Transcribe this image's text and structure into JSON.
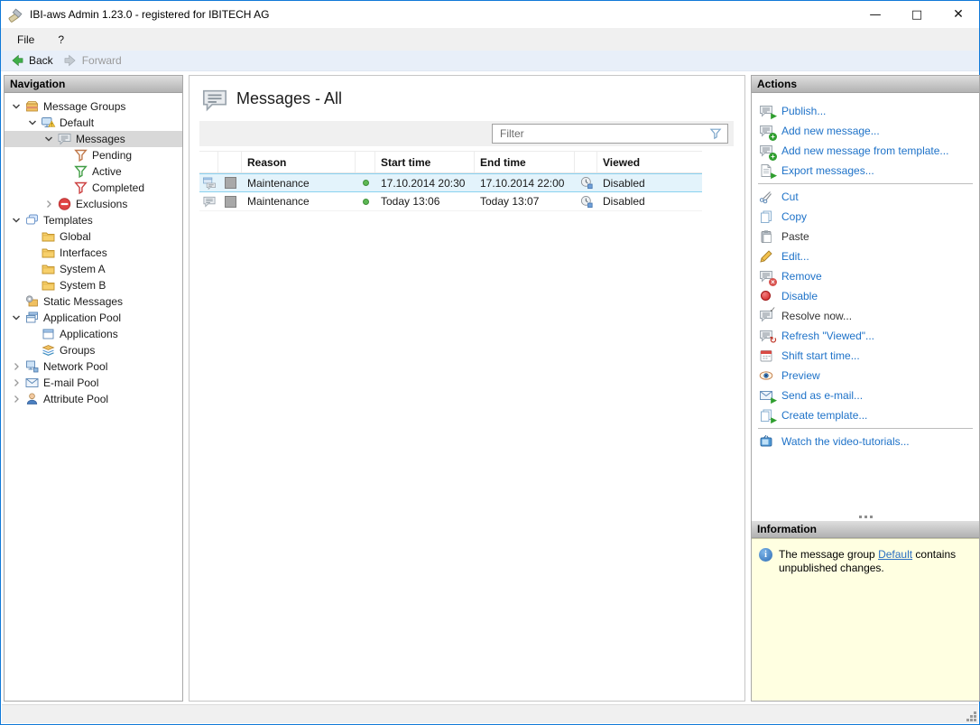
{
  "window": {
    "title": "IBI-aws Admin 1.23.0 - registered for IBITECH AG",
    "controls": {
      "minimize": "—",
      "maximize": "□",
      "close": "✕"
    }
  },
  "menu": {
    "file": "File",
    "help": "?"
  },
  "toolbar": {
    "back": "Back",
    "forward": "Forward"
  },
  "navigation": {
    "header": "Navigation",
    "items": [
      {
        "label": "Message Groups"
      },
      {
        "label": "Default"
      },
      {
        "label": "Messages"
      },
      {
        "label": "Pending"
      },
      {
        "label": "Active"
      },
      {
        "label": "Completed"
      },
      {
        "label": "Exclusions"
      },
      {
        "label": "Templates"
      },
      {
        "label": "Global"
      },
      {
        "label": "Interfaces"
      },
      {
        "label": "System A"
      },
      {
        "label": "System B"
      },
      {
        "label": "Static Messages"
      },
      {
        "label": "Application Pool"
      },
      {
        "label": "Applications"
      },
      {
        "label": "Groups"
      },
      {
        "label": "Network Pool"
      },
      {
        "label": "E-mail Pool"
      },
      {
        "label": "Attribute Pool"
      }
    ]
  },
  "main": {
    "title": "Messages - All",
    "filter": {
      "placeholder": "Filter"
    },
    "table": {
      "columns": {
        "reason": "Reason",
        "start": "Start time",
        "end": "End time",
        "viewed": "Viewed"
      },
      "rows": [
        {
          "reason": "Maintenance",
          "start": "17.10.2014 20:30",
          "end": "17.10.2014 22:00",
          "viewed": "Disabled"
        },
        {
          "reason": "Maintenance",
          "start": "Today 13:06",
          "end": "Today 13:07",
          "viewed": "Disabled"
        }
      ]
    }
  },
  "actions": {
    "header": "Actions",
    "items": [
      {
        "label": "Publish..."
      },
      {
        "label": "Add new message..."
      },
      {
        "label": "Add new message from template..."
      },
      {
        "label": "Export messages..."
      },
      {
        "label": "Cut"
      },
      {
        "label": "Copy"
      },
      {
        "label": "Paste"
      },
      {
        "label": "Edit..."
      },
      {
        "label": "Remove"
      },
      {
        "label": "Disable"
      },
      {
        "label": "Resolve now..."
      },
      {
        "label": "Refresh \"Viewed\"..."
      },
      {
        "label": "Shift start time..."
      },
      {
        "label": "Preview"
      },
      {
        "label": "Send as e-mail..."
      },
      {
        "label": "Create template..."
      },
      {
        "label": "Watch the video-tutorials..."
      }
    ]
  },
  "information": {
    "header": "Information",
    "text_before": "The message group ",
    "link_label": "Default",
    "text_after": " contains unpublished changes."
  },
  "colors": {
    "accent_border": "#1079d8",
    "action_link": "#1e72c8",
    "selected_row": "#e3f3fb",
    "info_background": "#ffffe1",
    "status_green": "#5db854"
  }
}
